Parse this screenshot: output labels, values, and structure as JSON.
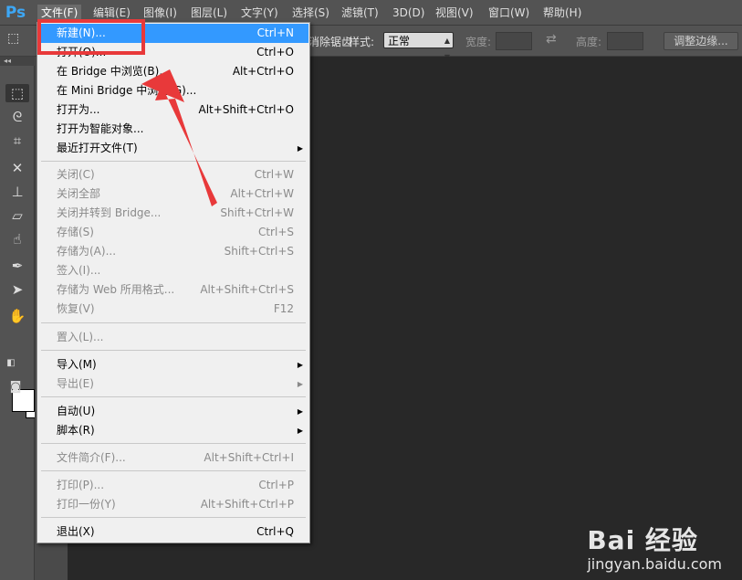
{
  "app": {
    "logo": "Ps"
  },
  "menubar": {
    "items": [
      "文件(F)",
      "编辑(E)",
      "图像(I)",
      "图层(L)",
      "文字(Y)",
      "选择(S)",
      "滤镜(T)",
      "3D(D)",
      "视图(V)",
      "窗口(W)",
      "帮助(H)"
    ]
  },
  "options_bar": {
    "partial_text": "消除锯齿",
    "style_label": "样式:",
    "style_value": "正常",
    "width_label": "宽度:",
    "height_label": "高度:",
    "refine_button": "调整边缘...",
    "swap_icon": "swap-icon"
  },
  "file_menu": {
    "items": [
      {
        "label": "新建(N)...",
        "shortcut": "Ctrl+N",
        "state": "highlighted"
      },
      {
        "label": "打开(O)...",
        "shortcut": "Ctrl+O",
        "state": "enabled"
      },
      {
        "label": "在 Bridge 中浏览(B)...",
        "shortcut": "Alt+Ctrl+O",
        "state": "enabled"
      },
      {
        "label": "在 Mini Bridge 中浏览(G)...",
        "shortcut": "",
        "state": "enabled"
      },
      {
        "label": "打开为...",
        "shortcut": "Alt+Shift+Ctrl+O",
        "state": "enabled"
      },
      {
        "label": "打开为智能对象...",
        "shortcut": "",
        "state": "enabled"
      },
      {
        "label": "最近打开文件(T)",
        "shortcut": "",
        "state": "enabled",
        "submenu": true
      },
      {
        "label": "关闭(C)",
        "shortcut": "Ctrl+W",
        "state": "disabled"
      },
      {
        "label": "关闭全部",
        "shortcut": "Alt+Ctrl+W",
        "state": "disabled"
      },
      {
        "label": "关闭并转到 Bridge...",
        "shortcut": "Shift+Ctrl+W",
        "state": "disabled"
      },
      {
        "label": "存储(S)",
        "shortcut": "Ctrl+S",
        "state": "disabled"
      },
      {
        "label": "存储为(A)...",
        "shortcut": "Shift+Ctrl+S",
        "state": "disabled"
      },
      {
        "label": "签入(I)...",
        "shortcut": "",
        "state": "disabled"
      },
      {
        "label": "存储为 Web 所用格式...",
        "shortcut": "Alt+Shift+Ctrl+S",
        "state": "disabled"
      },
      {
        "label": "恢复(V)",
        "shortcut": "F12",
        "state": "disabled"
      },
      {
        "label": "置入(L)...",
        "shortcut": "",
        "state": "disabled"
      },
      {
        "label": "导入(M)",
        "shortcut": "",
        "state": "enabled",
        "submenu": true
      },
      {
        "label": "导出(E)",
        "shortcut": "",
        "state": "disabled",
        "submenu": true
      },
      {
        "label": "自动(U)",
        "shortcut": "",
        "state": "enabled",
        "submenu": true
      },
      {
        "label": "脚本(R)",
        "shortcut": "",
        "state": "enabled",
        "submenu": true
      },
      {
        "label": "文件简介(F)...",
        "shortcut": "Alt+Shift+Ctrl+I",
        "state": "disabled"
      },
      {
        "label": "打印(P)...",
        "shortcut": "Ctrl+P",
        "state": "disabled"
      },
      {
        "label": "打印一份(Y)",
        "shortcut": "Alt+Shift+Ctrl+P",
        "state": "disabled"
      },
      {
        "label": "退出(X)",
        "shortcut": "Ctrl+Q",
        "state": "enabled"
      }
    ]
  },
  "watermark": {
    "line1": "Bai 经验",
    "line2": "jingyan.baidu.com"
  },
  "colors": {
    "highlight": "#3399ff",
    "annotation_red": "#e8393a",
    "ps_blue": "#3da7f5"
  }
}
